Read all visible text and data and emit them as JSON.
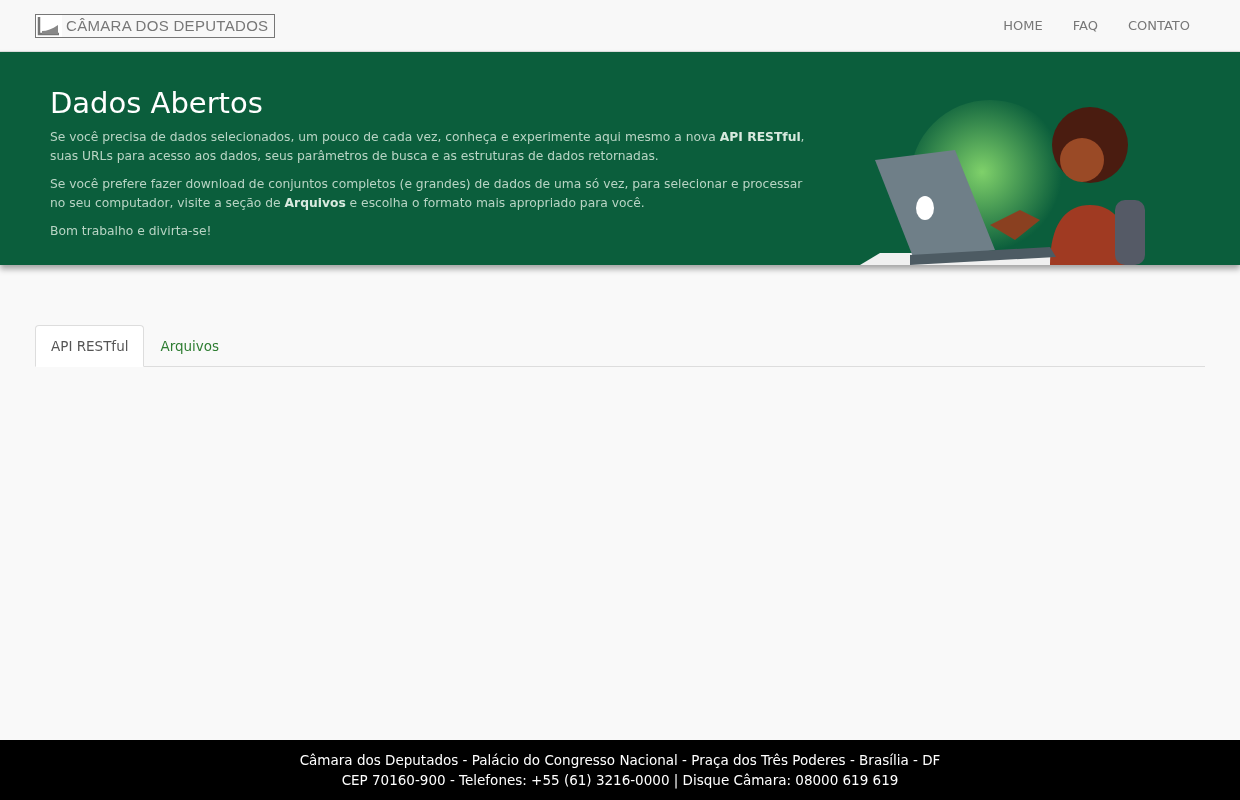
{
  "navbar": {
    "logo_text": "CÂMARA DOS DEPUTADOS",
    "links": [
      "HOME",
      "FAQ",
      "CONTATO"
    ]
  },
  "hero": {
    "title": "Dados Abertos",
    "paragraphs": [
      "Se você precisa de dados selecionados, um pouco de cada vez, conheça e experimente aqui mesmo a nova **API RESTful**, suas URLs para acesso aos dados, seus parâmetros de busca e as estruturas de dados retornadas.",
      "Se você prefere fazer download de conjuntos completos (e grandes) de dados de uma só vez, para selecionar e processar no seu computador, visite a seção de **Arquivos** e escolha o formato mais apropriado para você.",
      "Bom trabalho e divirta-se!"
    ]
  },
  "tabs": [
    {
      "label": "API RESTful",
      "selected": true
    },
    {
      "label": "Arquivos",
      "selected": false
    }
  ],
  "footer": [
    "Câmara dos Deputados - Palácio do Congresso Nacional - Praça dos Três Poderes - Brasília - DF",
    "CEP 70160-900 - Telefones: +55 (61) 3216-0000 | Disque Câmara: 08000 619 619"
  ]
}
